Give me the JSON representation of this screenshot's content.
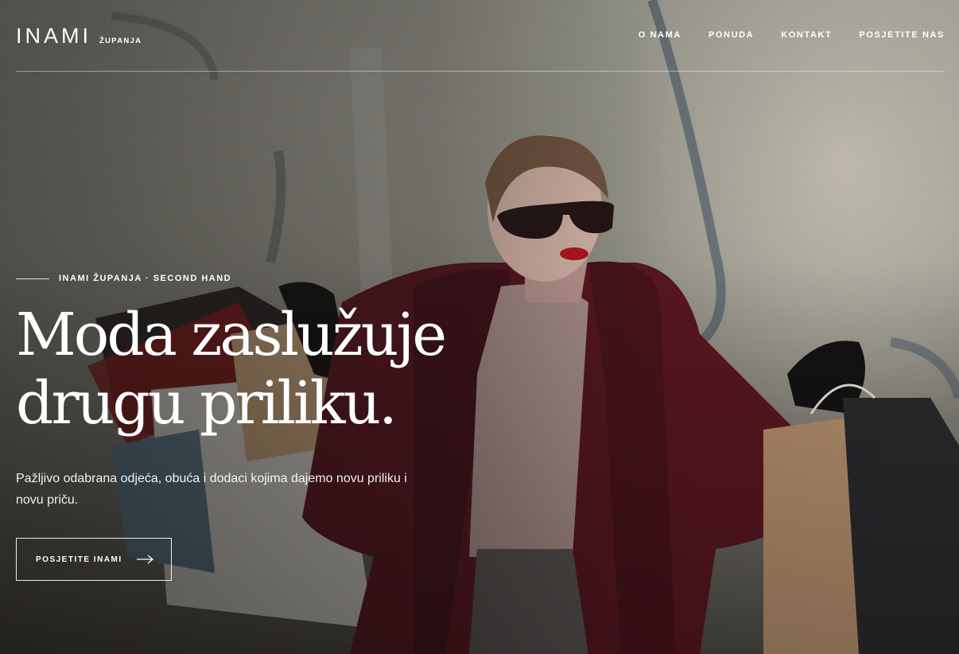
{
  "header": {
    "logo": "INAMI",
    "logo_sub": "ŽUPANJA",
    "nav": [
      "O NAMA",
      "PONUDA",
      "KONTAKT",
      "POSJETITE NAS"
    ]
  },
  "hero": {
    "eyebrow": "INAMI ŽUPANJA · SECOND HAND",
    "title_line1": "Moda zaslužuje",
    "title_line2": "drugu priliku.",
    "lead": "Pažljivo odabrana odjeća, obuća i dodaci kojima dajemo novu priliku i novu priču.",
    "cta_label": "POSJETITE INAMI",
    "cta_icon": "arrow-right-icon"
  },
  "colors": {
    "coat": "#5a1620",
    "text": "#ffffff"
  }
}
